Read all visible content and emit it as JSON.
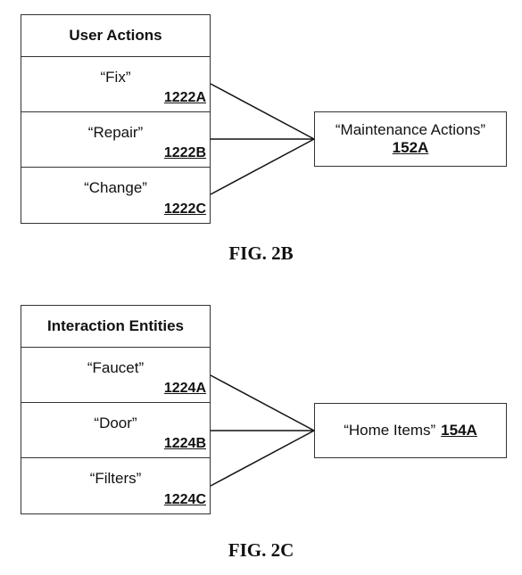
{
  "fig_2b": {
    "table": {
      "header": "User Actions",
      "rows": [
        {
          "label": "“Fix”",
          "ref": "1222A"
        },
        {
          "label": "“Repair”",
          "ref": "1222B"
        },
        {
          "label": "“Change”",
          "ref": "1222C"
        }
      ]
    },
    "target": {
      "label": "“Maintenance Actions”",
      "ref": "152A"
    },
    "caption": "FIG. 2B"
  },
  "fig_2c": {
    "table": {
      "header": "Interaction Entities",
      "rows": [
        {
          "label": "“Faucet”",
          "ref": "1224A"
        },
        {
          "label": "“Door”",
          "ref": "1224B"
        },
        {
          "label": "“Filters”",
          "ref": "1224C"
        }
      ]
    },
    "target": {
      "label": "“Home Items”",
      "ref": "154A"
    },
    "caption": "FIG. 2C"
  }
}
